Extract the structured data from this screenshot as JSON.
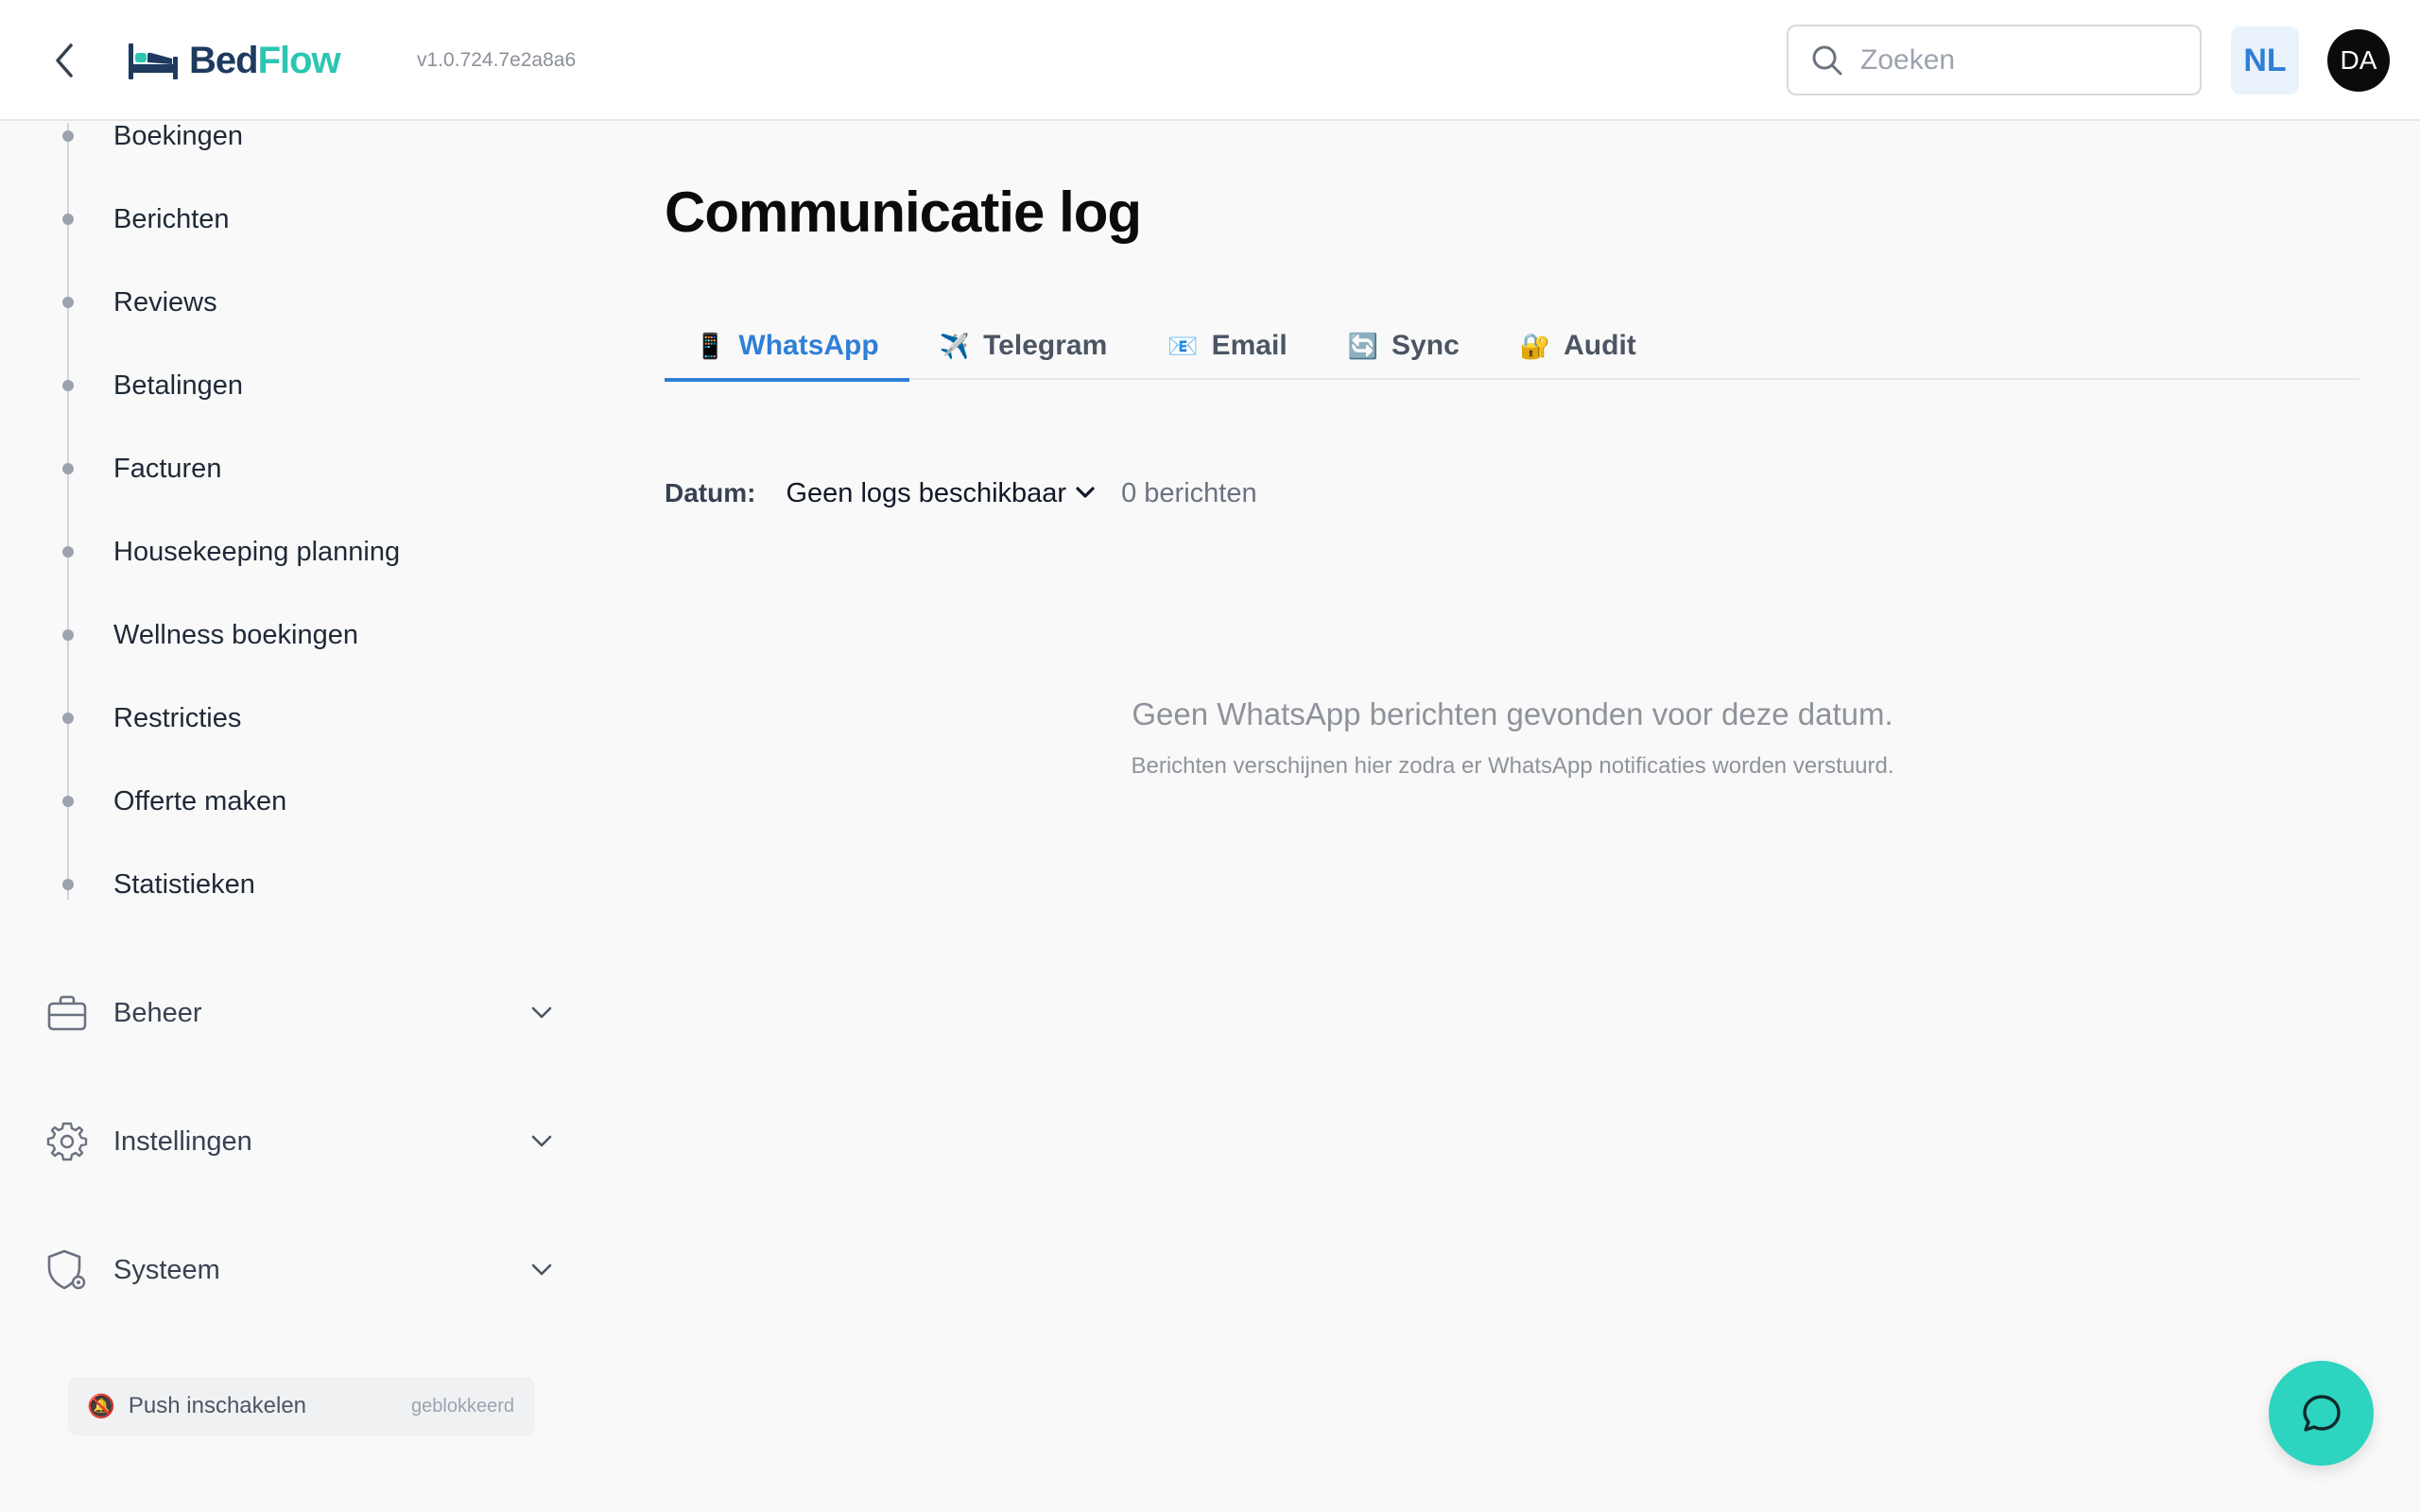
{
  "header": {
    "logo_part1": "Bed",
    "logo_part2": "Flow",
    "version": "v1.0.724.7e2a8a6",
    "search_placeholder": "Zoeken",
    "language": "NL",
    "avatar_initials": "DA"
  },
  "sidebar": {
    "sub_items": [
      "Boekingen",
      "Berichten",
      "Reviews",
      "Betalingen",
      "Facturen",
      "Housekeeping planning",
      "Wellness boekingen",
      "Restricties",
      "Offerte maken",
      "Statistieken"
    ],
    "groups": [
      {
        "label": "Beheer",
        "icon": "briefcase-icon"
      },
      {
        "label": "Instellingen",
        "icon": "gear-icon"
      },
      {
        "label": "Systeem",
        "icon": "shield-gear-icon"
      }
    ],
    "push": {
      "icon": "🔕",
      "label": "Push inschakelen",
      "status": "geblokkeerd"
    }
  },
  "main": {
    "title": "Communicatie log",
    "tabs": [
      {
        "icon": "📱",
        "label": "WhatsApp",
        "active": true
      },
      {
        "icon": "✈️",
        "label": "Telegram",
        "active": false
      },
      {
        "icon": "📧",
        "label": "Email",
        "active": false
      },
      {
        "icon": "🔄",
        "label": "Sync",
        "active": false
      },
      {
        "icon": "🔐",
        "label": "Audit",
        "active": false
      }
    ],
    "datum_label": "Datum:",
    "datum_value": "Geen logs beschikbaar",
    "message_count": "0 berichten",
    "empty_title": "Geen WhatsApp berichten gevonden voor deze datum.",
    "empty_subtitle": "Berichten verschijnen hier zodra er WhatsApp notificaties worden verstuurd."
  },
  "colors": {
    "accent": "#2f7fd6",
    "brand_dark": "#1e3a5f",
    "brand_teal": "#2cc6b3",
    "fab": "#2dd4bf"
  }
}
